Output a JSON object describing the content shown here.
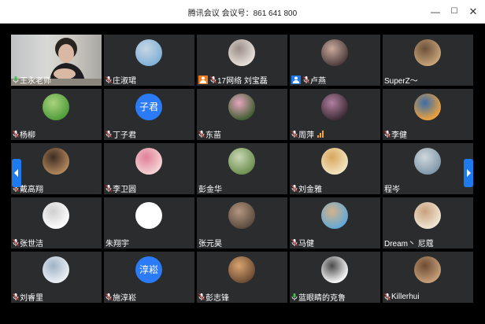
{
  "window": {
    "title": "腾讯会议 会议号：861 641 800",
    "minimize": "—",
    "maximize": "☐",
    "close": "✕"
  },
  "participants": [
    {
      "name": "王永老师",
      "mic": "on",
      "avatar": "camera"
    },
    {
      "name": "庄淑珺",
      "mic": "muted",
      "avatar": "photo",
      "colors": [
        "#7fb0d8",
        "#c7d6e2"
      ]
    },
    {
      "name": "17网络 刘宝磊",
      "mic": "muted",
      "screen": "orange",
      "avatar": "photo",
      "colors": [
        "#e9e2db",
        "#9b8e88"
      ]
    },
    {
      "name": "卢燕",
      "mic": "muted",
      "screen": "blue",
      "avatar": "photo",
      "colors": [
        "#4c3b3b",
        "#c9a99b"
      ]
    },
    {
      "name": "SuperZ～",
      "mic": "none",
      "avatar": "photo",
      "colors": [
        "#c9a77a",
        "#6b4f3a"
      ]
    },
    {
      "name": "杨柳",
      "mic": "muted",
      "avatar": "photo",
      "colors": [
        "#4e9b3a",
        "#a9d37d"
      ]
    },
    {
      "name": "丁子君",
      "mic": "muted",
      "avatar": "text",
      "avatar_text": "子君"
    },
    {
      "name": "东苗",
      "mic": "muted",
      "avatar": "photo",
      "colors": [
        "#3d5c2e",
        "#e7a6c0"
      ]
    },
    {
      "name": "周萍",
      "mic": "muted",
      "signal": true,
      "avatar": "photo",
      "colors": [
        "#3b2a33",
        "#b07fa0"
      ]
    },
    {
      "name": "李健",
      "mic": "muted",
      "avatar": "photo",
      "colors": [
        "#f2a33a",
        "#3a6da8"
      ]
    },
    {
      "name": "戴高翔",
      "mic": "muted",
      "avatar": "photo",
      "colors": [
        "#b58a5e",
        "#3d2c22"
      ]
    },
    {
      "name": "李卫圆",
      "mic": "muted",
      "avatar": "photo",
      "colors": [
        "#f6d6d6",
        "#e07f98"
      ]
    },
    {
      "name": "彭金华",
      "mic": "none",
      "avatar": "photo",
      "colors": [
        "#6b8e4e",
        "#c9d7b4"
      ]
    },
    {
      "name": "刘金雅",
      "mic": "muted",
      "avatar": "photo",
      "colors": [
        "#f3e6c6",
        "#d8a65b"
      ]
    },
    {
      "name": "程岑",
      "mic": "none",
      "avatar": "photo",
      "colors": [
        "#7f97a8",
        "#d0d8dd"
      ]
    },
    {
      "name": "张世洁",
      "mic": "muted",
      "avatar": "photo",
      "colors": [
        "#ffffff",
        "#cfcfcf"
      ]
    },
    {
      "name": "朱翔宇",
      "mic": "none",
      "avatar": "plain"
    },
    {
      "name": "张元昊",
      "mic": "none",
      "avatar": "photo",
      "colors": [
        "#5a4a3e",
        "#b3967e"
      ]
    },
    {
      "name": "马健",
      "mic": "muted",
      "avatar": "photo",
      "colors": [
        "#5fa8d9",
        "#d4b28a"
      ]
    },
    {
      "name": "Dream丶 尼蔻",
      "mic": "none",
      "avatar": "photo",
      "colors": [
        "#f0e8d4",
        "#c8a17e"
      ]
    },
    {
      "name": "刘睿里",
      "mic": "muted",
      "avatar": "photo",
      "colors": [
        "#eef2f6",
        "#9fb2c5"
      ]
    },
    {
      "name": "施淳崧",
      "mic": "muted",
      "avatar": "text",
      "avatar_text": "淳崧"
    },
    {
      "name": "彭志锋",
      "mic": "muted",
      "avatar": "photo",
      "colors": [
        "#6a4a35",
        "#d9a46d"
      ]
    },
    {
      "name": "蓝眼睛的克鲁",
      "mic": "on",
      "avatar": "photo",
      "colors": [
        "#ffffff",
        "#4a4a4a"
      ]
    },
    {
      "name": "Killerhui",
      "mic": "muted",
      "avatar": "photo",
      "colors": [
        "#c9a27c",
        "#6e4a32"
      ]
    }
  ],
  "nav": {
    "left_icon": "chevron-left-icon",
    "right_icon": "chevron-right-icon",
    "accent": "#1e7bef"
  }
}
